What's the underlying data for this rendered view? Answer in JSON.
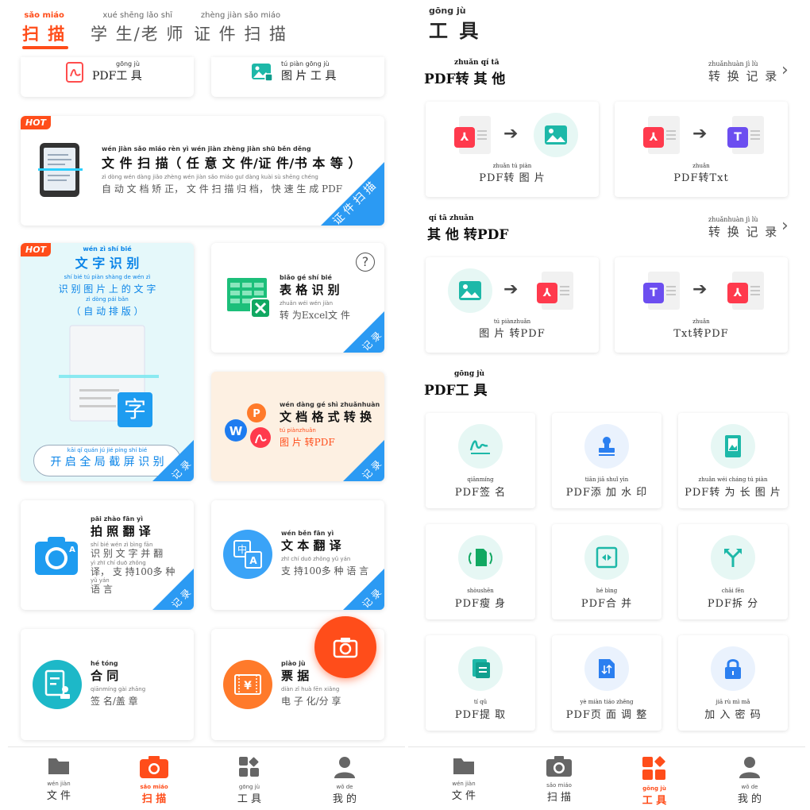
{
  "left": {
    "tabs": [
      {
        "py": "sǎo miáo",
        "label": "扫 描"
      },
      {
        "py": "xué shēng   lǎo   shī",
        "label": "学 生/老 师"
      },
      {
        "py": "zhèng jiàn  sǎo miáo",
        "label": "证 件 扫 描"
      }
    ],
    "top_tools": [
      {
        "py": "gōng  jù",
        "label": "PDF工 具"
      },
      {
        "py": "tú  piàn gōng  jù",
        "label": "图 片 工 具"
      }
    ],
    "hot_label": "HOT",
    "doc_scan": {
      "py": "wén jiàn  sǎo miáo     rèn   yì  wén jiàn  zhèng jiàn    shū  běn děng",
      "title": "文 件 扫 描（ 任 意 文 件/证 件/书 本 等 ）",
      "desc_py": "zì  dòng wén dàng jiǎo zhèng      wén jiàn  sǎo miáo guī dàng      kuài  sù  shēng chéng",
      "desc": "自 动 文 档 矫 正， 文 件 扫 描 归 档， 快 速 生 成 PDF",
      "corner_py": "zhèng jiàn sǎo miáo",
      "corner": "证 件 扫 描"
    },
    "ocr": {
      "title_py": "wén  zì   shí  bié",
      "title": "文 字 识 别",
      "desc_py": "shí  bié  tú  piàn shàng de  wén  zì",
      "desc": "识 别 图 片 上 的 文 字",
      "desc2_py": "zì  dòng pái bǎn",
      "desc2": "（ 自 动 排 版 ）",
      "glyph": "字",
      "btn_py": "kāi  qǐ  quán  jú    jié  píng shí  bié",
      "btn": "开 启 全 局 截 屏 识 别",
      "corner": "记 录"
    },
    "table": {
      "title_py": "biǎo  gé   shí  bié",
      "title": "表 格 识 别",
      "desc_py": "zhuǎn wéi                wén jiàn",
      "desc": "转 为Excel文 件",
      "help": "?",
      "corner": "记 录"
    },
    "format": {
      "title_py": "wén dàng  gé   shì zhuǎnhuàn",
      "title": "文 档 格 式 转 换",
      "desc_py": "tú  piànzhuǎn",
      "desc": "图 片 转PDF",
      "corner": "记 录"
    },
    "photo_translate": {
      "title_py": "pāi zhào fān   yì",
      "title": "拍 照 翻 译",
      "desc_py": "shí  bié wén   zì   bìng fān",
      "desc": "识 别 文 字 并 翻",
      "desc2_py": "yì              zhī  chí                duō zhǒng",
      "desc2": "译， 支 持100多 种",
      "desc3_py": "yǔ yán",
      "desc3": "语 言",
      "corner": "记 录"
    },
    "text_translate": {
      "title_py": "wén  běn  fān   yì",
      "title": "文 本 翻 译",
      "desc_py": "zhī  chí              duō zhǒng yǔ  yán",
      "desc": "支 持100多 种 语 言",
      "corner": "记 录"
    },
    "contract": {
      "title_py": "hé  tóng",
      "title": "合 同",
      "desc_py": "qiānmíng     gài zhāng",
      "desc": "签 名/盖 章"
    },
    "receipt": {
      "title_py": "piào  jù",
      "title": "票 据",
      "desc_py": "diàn  zǐ  huà     fēn xiǎng",
      "desc": "电 子 化/分 享"
    },
    "nav": [
      {
        "py": "wén jiàn",
        "label": "文 件"
      },
      {
        "py": "sǎo miáo",
        "label": "扫 描"
      },
      {
        "py": "gōng  jù",
        "label": "工 具"
      },
      {
        "py": "wǒ   de",
        "label": "我 的"
      }
    ]
  },
  "right": {
    "header_py": "gōng   jù",
    "header": "工 具",
    "sec1": {
      "py": "zhuǎn  qí   tā",
      "title": "PDF转 其 他",
      "hist_py": "zhuǎnhuàn   jì    lù",
      "hist": "转 换 记 录"
    },
    "sec2": {
      "py": "qí   tā  zhuǎn",
      "title": "其 他 转PDF",
      "hist_py": "zhuǎnhuàn   jì    lù",
      "hist": "转 换 记 录"
    },
    "sec3": {
      "py": "gōng  jù",
      "title": "PDF工 具"
    },
    "conv": [
      {
        "py": "zhuǎn  tú  piàn",
        "label": "PDF转 图 片"
      },
      {
        "py": "zhuǎn",
        "label": "PDF转Txt"
      },
      {
        "py": "tú  piànzhuǎn",
        "label": "图 片 转PDF"
      },
      {
        "py": "zhuǎn",
        "label": "Txt转PDF"
      }
    ],
    "tools": [
      {
        "py": "qiānmíng",
        "label": "PDF签 名"
      },
      {
        "py": "tiān  jiā  shuǐ  yìn",
        "label": "PDF添 加 水 印"
      },
      {
        "py": "zhuǎn wéi cháng  tú  piàn",
        "label": "PDF转 为 长 图 片"
      },
      {
        "py": "shòushēn",
        "label": "PDF瘦 身"
      },
      {
        "py": "hé  bìng",
        "label": "PDF合 并"
      },
      {
        "py": "chāi  fēn",
        "label": "PDF拆 分"
      },
      {
        "py": "tí   qǔ",
        "label": "PDF提 取"
      },
      {
        "py": "yè  miàn tiáo zhěng",
        "label": "PDF页 面 调 整"
      },
      {
        "py": "jiā   rù   mì   mǎ",
        "label": "加 入 密 码"
      }
    ],
    "nav": [
      {
        "py": "wén jiàn",
        "label": "文 件"
      },
      {
        "py": "sǎo miáo",
        "label": "扫 描"
      },
      {
        "py": "gōng  jù",
        "label": "工 具"
      },
      {
        "py": "wǒ   de",
        "label": "我 的"
      }
    ]
  },
  "colors": {
    "accent": "#ff4d1a",
    "blue": "#2b9af3",
    "teal": "#1db8a8",
    "mint": "#e6f7f4"
  }
}
